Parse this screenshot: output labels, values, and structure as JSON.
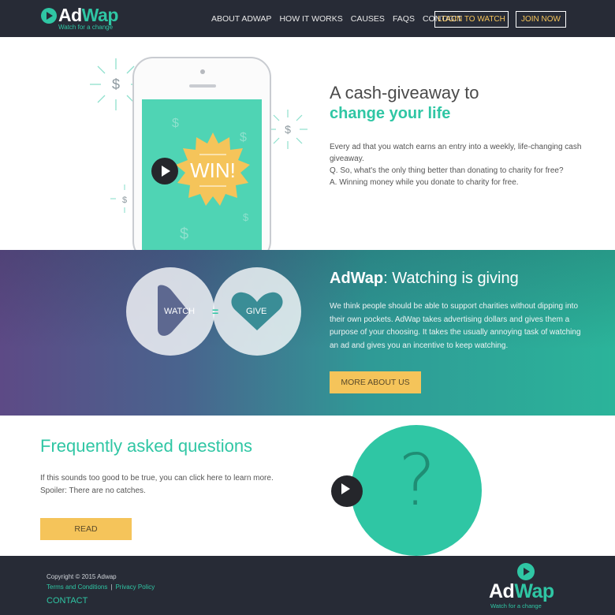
{
  "brand": {
    "name_part1": "Ad",
    "name_part2": "Wap",
    "tagline": "Watch for a change"
  },
  "nav": {
    "links": [
      "ABOUT ADWAP",
      "HOW IT WORKS",
      "CAUSES",
      "FAQS",
      "CONTACT"
    ],
    "login_label": "LOGIN TO WATCH",
    "join_label": "JOIN NOW"
  },
  "hero": {
    "title_line1": "A cash-giveaway to",
    "title_line2": "change your life",
    "win_label": "WIN!",
    "paragraphs": [
      "Every ad that you watch earns an entry into a weekly, life-changing cash giveaway.",
      "Q. So, what's the only thing better than donating to charity for free?",
      "A. Winning money while you donate to charity for free."
    ]
  },
  "band": {
    "title_bold": "AdWap",
    "title_rest": ": Watching is giving",
    "watch_label": "WATCH",
    "equals": "=",
    "give_label": "GIVE",
    "body": "We think people should be able to support charities without dipping into their own pockets. AdWap takes advertising dollars and gives them a purpose of your choosing. It takes the usually annoying task of watching an ad and gives you an incentive to keep watching.",
    "button_label": "MORE ABOUT US"
  },
  "faq": {
    "title": "Frequently asked questions",
    "line1": "If this sounds too good to be true, you can click here to learn more.",
    "line2": "Spoiler: There are no catches.",
    "button_label": "READ",
    "question_mark": "?"
  },
  "footer": {
    "copyright": "Copyright © 2015 Adwap",
    "terms": "Terms and Conditions",
    "separator": "|",
    "privacy": "Privacy Policy",
    "contact": "CONTACT"
  },
  "colors": {
    "teal": "#2fc6a4",
    "dark": "#272b36",
    "yellow": "#f5c45a"
  },
  "icons": [
    "play-icon",
    "dollar-icon",
    "heart-icon",
    "question-icon"
  ]
}
